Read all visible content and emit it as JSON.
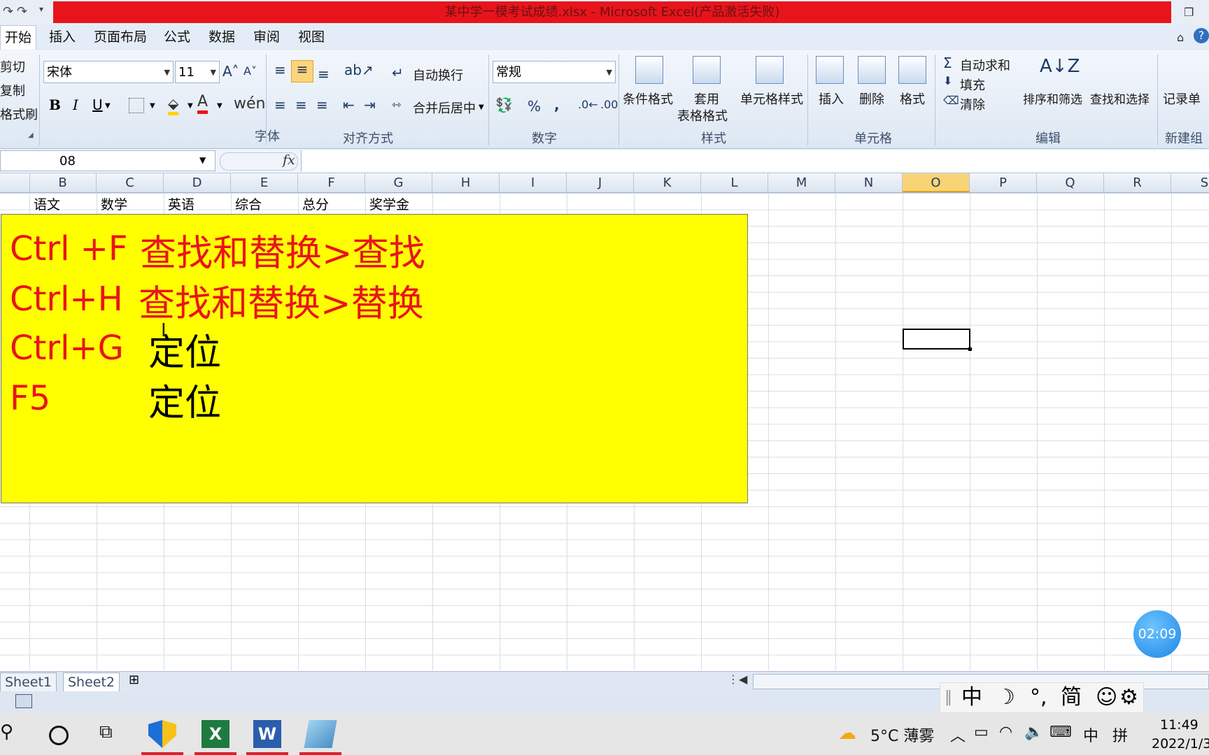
{
  "window": {
    "title": "某中学一模考试成绩.xlsx - Microsoft Excel(产品激活失败)"
  },
  "tabs": [
    "开始",
    "插入",
    "页面布局",
    "公式",
    "数据",
    "审阅",
    "视图"
  ],
  "ribbon": {
    "clipboard": {
      "cut": "剪切",
      "copy": "复制",
      "format_painter": "格式刷"
    },
    "font": {
      "name": "宋体",
      "size": "11",
      "label": "字体"
    },
    "alignment": {
      "wrap": "自动换行",
      "merge": "合并后居中",
      "label": "对齐方式"
    },
    "number": {
      "format": "常规",
      "label": "数字"
    },
    "styles": {
      "conditional": "条件格式",
      "table_l1": "套用",
      "table_l2": "表格格式",
      "cell_styles": "单元格样式",
      "label": "样式"
    },
    "cells": {
      "insert": "插入",
      "delete": "删除",
      "format": "格式",
      "label": "单元格"
    },
    "editing": {
      "autosum": "自动求和",
      "fill": "填充",
      "clear": "清除",
      "sort": "排序和筛选",
      "find": "查找和选择",
      "label": "编辑"
    },
    "new_group": {
      "record": "记录单",
      "label": "新建组"
    }
  },
  "formula_bar": {
    "name_box": "08",
    "fx": "fx",
    "value": ""
  },
  "columns": [
    "B",
    "C",
    "D",
    "E",
    "F",
    "G",
    "H",
    "I",
    "J",
    "K",
    "L",
    "M",
    "N",
    "O",
    "P",
    "Q",
    "R",
    "S"
  ],
  "header_row": [
    "语文",
    "数学",
    "英语",
    "综合",
    "总分",
    "奖学金"
  ],
  "shortcuts": [
    {
      "key": "Ctrl +F",
      "desc": "查找和替换>查找",
      "color": "#e8141c"
    },
    {
      "key": "Ctrl+H",
      "desc": "查找和替换>替换",
      "color": "#e8141c"
    },
    {
      "key": "Ctrl+G",
      "desc": "定位",
      "color": "#000000"
    },
    {
      "key": "F5",
      "desc": "定位",
      "color": "#000000"
    }
  ],
  "sheets": [
    "Sheet1",
    "Sheet2"
  ],
  "watermark": {
    "timer": "02:09"
  },
  "ime": [
    "中",
    "简"
  ],
  "taskbar": {
    "weather": "5°C 薄雾",
    "ime_mode": "中",
    "ime_layout": "拼",
    "time": "11:49",
    "date": "2022/1/3"
  }
}
